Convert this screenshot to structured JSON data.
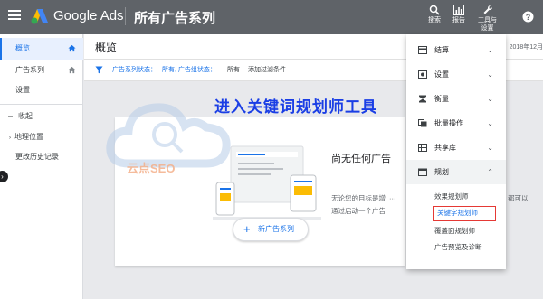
{
  "topbar": {
    "product": "Google Ads",
    "page_heading": "所有广告系列",
    "search_label": "搜索",
    "reports_label": "报告",
    "tools_label_line1": "工具与",
    "tools_label_line2": "设置",
    "help_icon": "help-icon"
  },
  "sidebar": {
    "items": [
      {
        "label": "概览",
        "active": true
      },
      {
        "label": "广告系列"
      },
      {
        "label": "设置"
      },
      {
        "label": "收起"
      },
      {
        "label": "地理位置"
      },
      {
        "label": "更改历史记录"
      }
    ]
  },
  "main": {
    "title": "概览",
    "date_fragment": "2018年12月",
    "filter": {
      "label": "广告系列状态：",
      "value": "所有, 广告组状态：",
      "value2": "所有",
      "add": "添加过滤条件"
    }
  },
  "overlay": {
    "banner_text": "进入关键词规划师工具",
    "watermark_text": "云点SEO"
  },
  "card": {
    "empty_title": "尚无任何广告",
    "empty_desc_line1": "无论您的目标是增",
    "empty_desc_line1_tail": "都可以",
    "empty_desc_line2": "通过启动一个广告",
    "new_campaign": "新广告系列"
  },
  "dropdown": {
    "items": [
      {
        "label": "结算",
        "icon": "card-icon"
      },
      {
        "label": "设置",
        "icon": "gear-icon"
      },
      {
        "label": "衡量",
        "icon": "hourglass-icon"
      },
      {
        "label": "批量操作",
        "icon": "copy-icon"
      },
      {
        "label": "共享库",
        "icon": "grid-icon"
      },
      {
        "label": "规划",
        "icon": "calendar-icon"
      }
    ],
    "planning_sub": [
      "效果规划师",
      "关键字规划师",
      "覆盖面规划师",
      "广告预览及诊断"
    ]
  },
  "colors": {
    "topbar": "#5f6368",
    "accent": "#1a73e8",
    "highlight_box": "#e53935",
    "banner": "#1a3ee5"
  }
}
